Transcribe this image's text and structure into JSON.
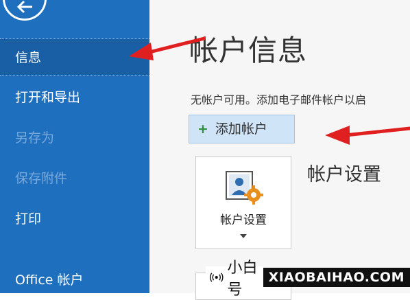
{
  "sidebar": {
    "items": [
      {
        "label": "信息",
        "state": "active"
      },
      {
        "label": "打开和导出",
        "state": "normal"
      },
      {
        "label": "另存为",
        "state": "disabled"
      },
      {
        "label": "保存附件",
        "state": "disabled"
      },
      {
        "label": "打印",
        "state": "normal"
      },
      {
        "label": "Office 帐户",
        "state": "normal"
      }
    ]
  },
  "main": {
    "title": "帐户信息",
    "description": "无帐户可用。添加电子邮件帐户以启",
    "add_account_label": "添加帐户",
    "settings_tile_label": "帐户设置",
    "section_heading": "帐户设置"
  },
  "watermark": {
    "brand": "小白号",
    "url": "XIAOBAIHAO.COM"
  },
  "colors": {
    "sidebar_bg": "#1f6fbf",
    "sidebar_active_bg": "#195fa6",
    "sidebar_disabled_text": "#79a9da",
    "add_button_bg": "#cfe4f7",
    "annotation_arrow": "#e02020",
    "gear_accent": "#e8901c"
  },
  "icons": [
    "back-arrow-icon",
    "plus-icon",
    "account-settings-icon",
    "gear-icon",
    "chevron-down-icon",
    "broadcast-icon"
  ]
}
